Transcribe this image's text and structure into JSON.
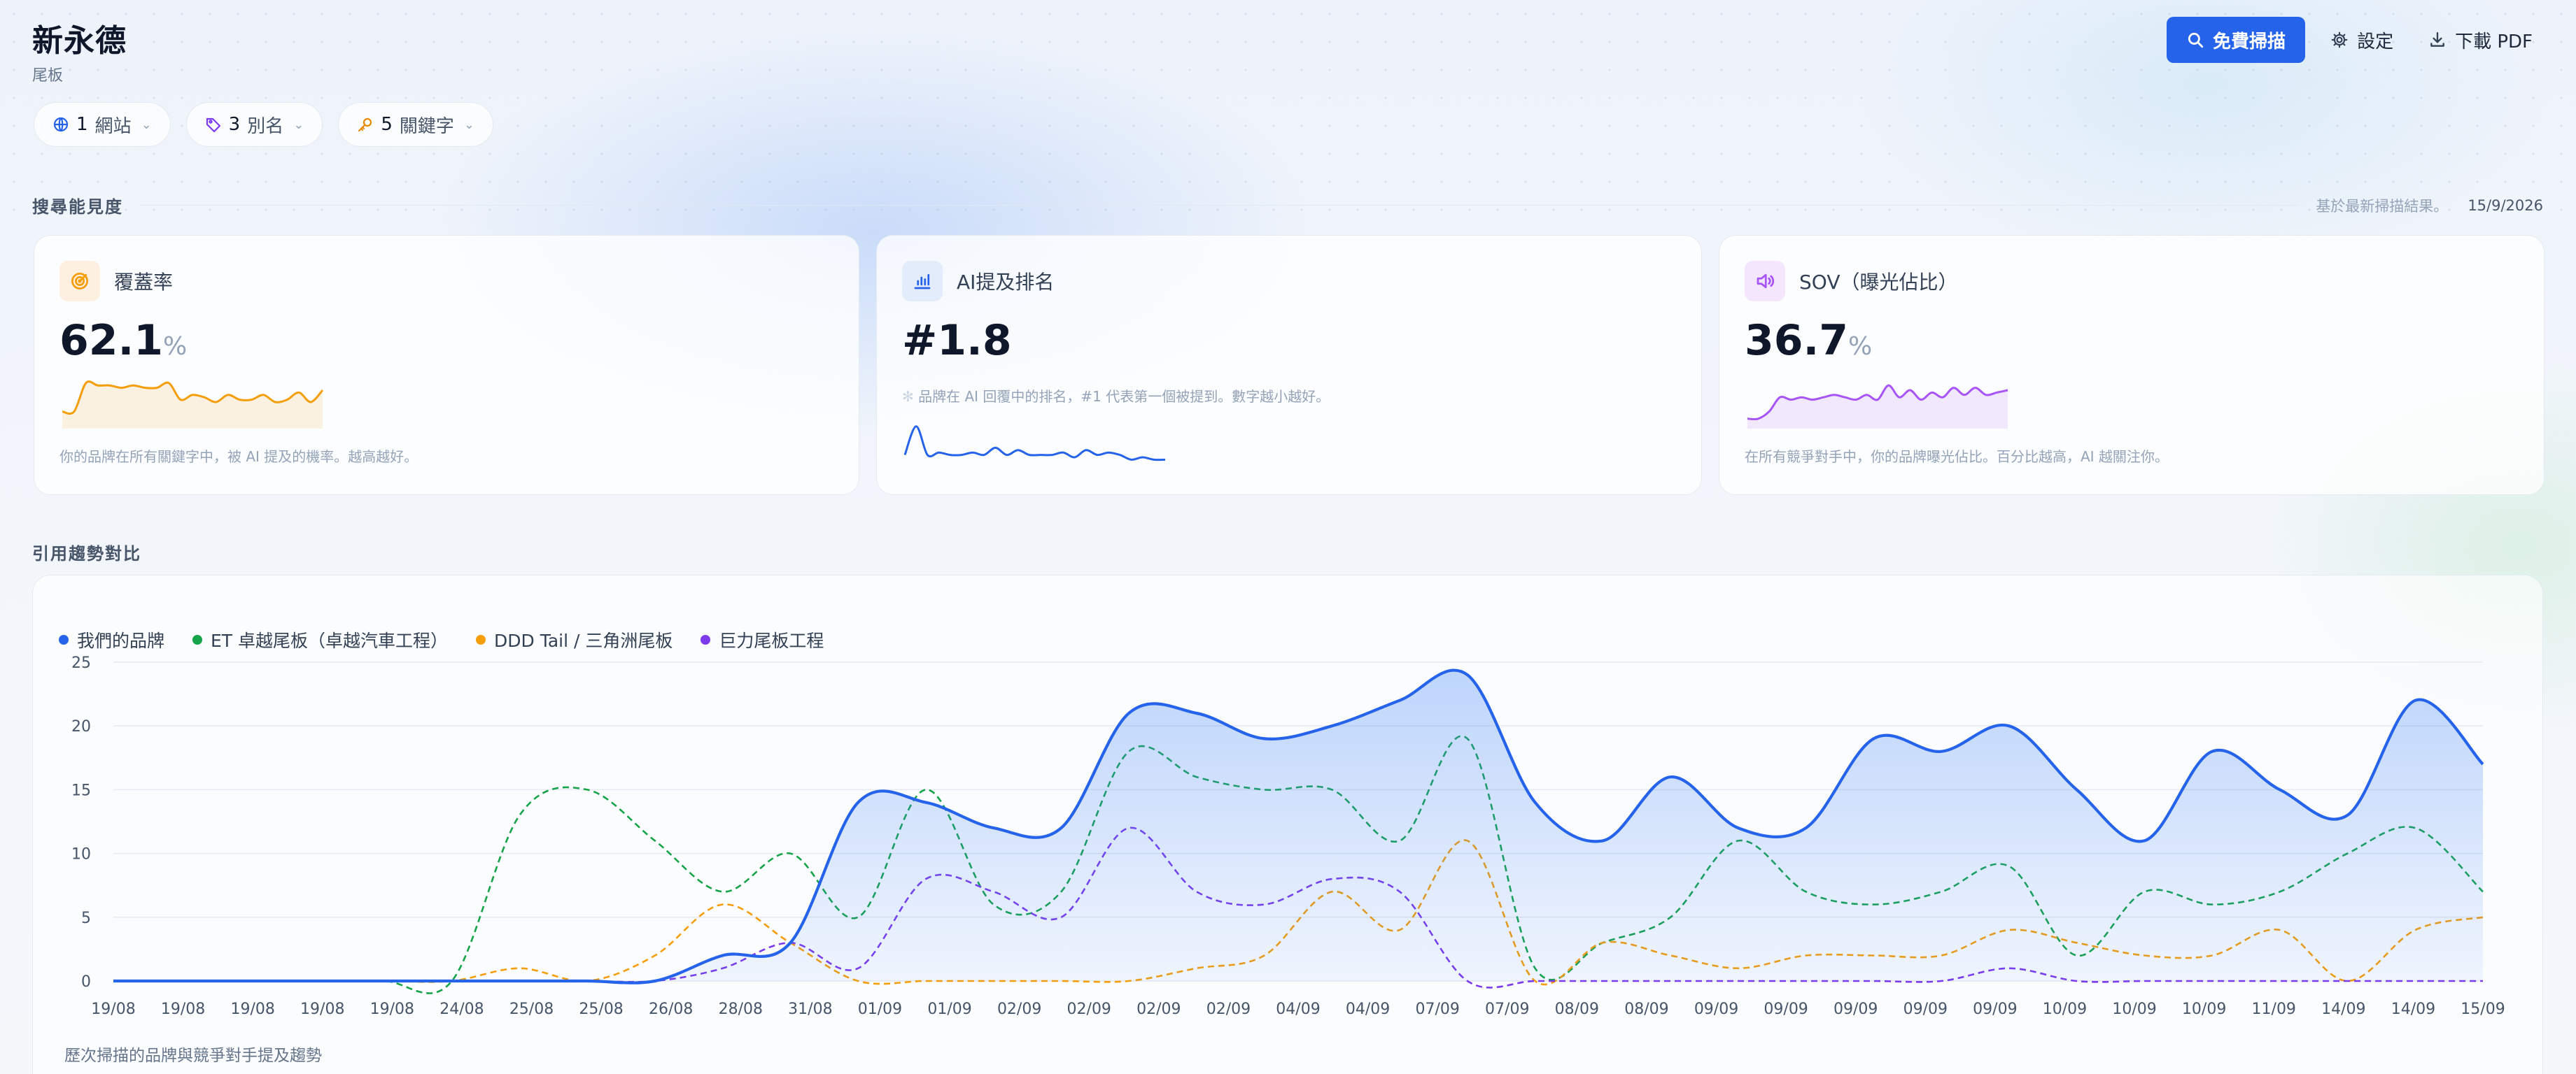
{
  "header": {
    "title": "新永德",
    "subtitle": "尾板",
    "scan_label": "免費掃描",
    "settings_label": "設定",
    "pdf_label": "下載 PDF"
  },
  "chips": [
    {
      "icon": "globe-icon",
      "count": "1",
      "label": "網站",
      "color": "#2563eb"
    },
    {
      "icon": "tag-icon",
      "count": "3",
      "label": "別名",
      "color": "#7c3aed"
    },
    {
      "icon": "key-icon",
      "count": "5",
      "label": "關鍵字",
      "color": "#ea8a00"
    }
  ],
  "visibility": {
    "title": "搜尋能見度",
    "note": "基於最新掃描結果。",
    "date": "15/9/2026"
  },
  "cards": {
    "coverage": {
      "label": "覆蓋率",
      "value": "62.1",
      "unit": "%",
      "desc": "你的品牌在所有關鍵字中，被 AI 提及的機率。越高越好。",
      "color": "#f59e0b",
      "icon": "target-icon"
    },
    "rank": {
      "label": "AI提及排名",
      "value": "#1.8",
      "desc": "品牌在 AI 回覆中的排名，#1 代表第一個被提到。數字越小越好。",
      "color": "#2563eb",
      "icon": "bar-chart-icon"
    },
    "sov": {
      "label": "SOV（曝光佔比）",
      "value": "36.7",
      "unit": "%",
      "desc": "在所有競爭對手中，你的品牌曝光佔比。百分比越高，AI 越關注你。",
      "color": "#a855f7",
      "icon": "speaker-icon"
    }
  },
  "trend": {
    "title": "引用趨勢對比",
    "footer": "歷次掃描的品牌與競爭對手提及趨勢"
  },
  "colors": {
    "brand": "#2563eb",
    "competitor_green": "#16a34a",
    "competitor_orange": "#f59e0b",
    "competitor_purple": "#7c3aed"
  },
  "chart_data": {
    "type": "line",
    "x": [
      "19/08",
      "19/08",
      "19/08",
      "19/08",
      "19/08",
      "24/08",
      "25/08",
      "25/08",
      "26/08",
      "28/08",
      "31/08",
      "01/09",
      "01/09",
      "02/09",
      "02/09",
      "02/09",
      "02/09",
      "04/09",
      "04/09",
      "07/09",
      "07/09",
      "08/09",
      "08/09",
      "09/09",
      "09/09",
      "09/09",
      "09/09",
      "09/09",
      "10/09",
      "10/09",
      "10/09",
      "11/09",
      "14/09",
      "14/09",
      "15/09"
    ],
    "yticks": [
      0,
      5,
      10,
      15,
      20,
      25
    ],
    "ylim": [
      0,
      25
    ],
    "grid": true,
    "legend_position": "top-left",
    "series": [
      {
        "name": "我們的品牌",
        "color": "#2563eb",
        "dashed": false,
        "filled": true,
        "values": [
          0,
          0,
          0,
          0,
          0,
          0,
          0,
          0,
          0,
          2,
          3,
          14,
          14,
          12,
          12,
          21,
          21,
          19,
          20,
          22,
          24,
          14,
          11,
          16,
          12,
          12,
          19,
          18,
          20,
          15,
          11,
          18,
          15,
          13,
          22,
          17
        ]
      },
      {
        "name": "ET 卓越尾板（卓越汽車工程）",
        "color": "#16a34a",
        "dashed": true,
        "values": [
          0,
          0,
          0,
          0,
          0,
          0,
          13,
          15,
          11,
          7,
          10,
          5,
          15,
          6,
          7,
          18,
          16,
          15,
          15,
          11,
          19,
          1,
          3,
          5,
          11,
          7,
          6,
          7,
          9,
          2,
          7,
          6,
          7,
          10,
          12,
          7
        ]
      },
      {
        "name": "DDD Tail / 三角洲尾板",
        "color": "#f59e0b",
        "dashed": true,
        "values": [
          0,
          0,
          0,
          0,
          0,
          0,
          1,
          0,
          2,
          6,
          3,
          0,
          0,
          0,
          0,
          0,
          1,
          2,
          7,
          4,
          11,
          0,
          3,
          2,
          1,
          2,
          2,
          2,
          4,
          3,
          2,
          2,
          4,
          0,
          4,
          5
        ]
      },
      {
        "name": "巨力尾板工程",
        "color": "#7c3aed",
        "dashed": true,
        "values": [
          0,
          0,
          0,
          0,
          0,
          0,
          0,
          0,
          0,
          1,
          3,
          1,
          8,
          7,
          5,
          12,
          7,
          6,
          8,
          7,
          0,
          0,
          0,
          0,
          0,
          0,
          0,
          0,
          1,
          0,
          0,
          0,
          0,
          0,
          0,
          0
        ]
      }
    ]
  },
  "sparklines": {
    "coverage": [
      0.3,
      0.3,
      0.9,
      0.85,
      0.85,
      0.8,
      0.85,
      0.8,
      0.8,
      0.9,
      0.55,
      0.65,
      0.6,
      0.5,
      0.65,
      0.55,
      0.55,
      0.65,
      0.5,
      0.55,
      0.7,
      0.5,
      0.75
    ],
    "rank": [
      0.3,
      0.9,
      0.3,
      0.35,
      0.3,
      0.3,
      0.35,
      0.3,
      0.45,
      0.3,
      0.4,
      0.3,
      0.3,
      0.3,
      0.35,
      0.25,
      0.4,
      0.3,
      0.35,
      0.3,
      0.2,
      0.25,
      0.2,
      0.2
    ],
    "sov": [
      0.15,
      0.15,
      0.3,
      0.6,
      0.55,
      0.6,
      0.55,
      0.6,
      0.65,
      0.6,
      0.55,
      0.65,
      0.55,
      0.85,
      0.6,
      0.75,
      0.55,
      0.7,
      0.6,
      0.8,
      0.65,
      0.8,
      0.65,
      0.7,
      0.75
    ]
  }
}
